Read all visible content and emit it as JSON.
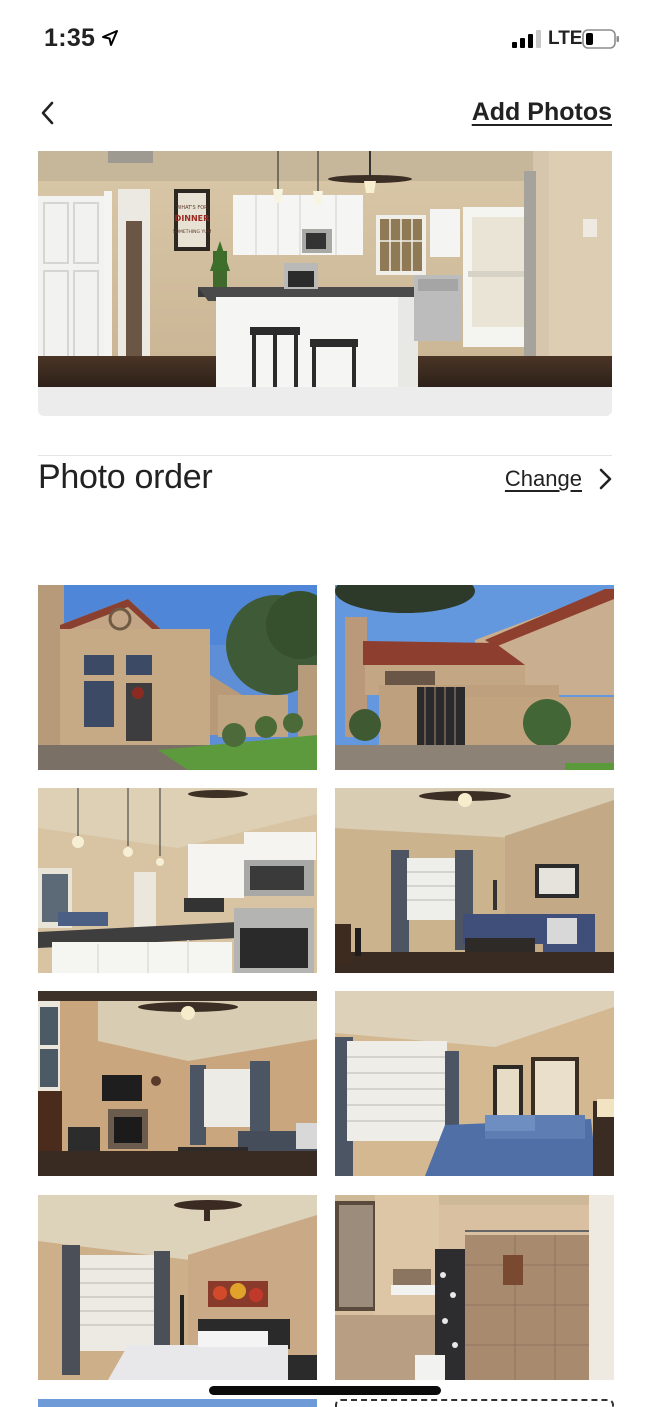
{
  "status_bar": {
    "time": "1:35",
    "network": "LTE",
    "icons": [
      "location-arrow-icon",
      "cellular-signal-icon",
      "battery-icon"
    ],
    "signal_bars": 3
  },
  "nav": {
    "back_icon": "chevron-left-icon",
    "add_photos_label": "Add Photos"
  },
  "hero_photo": {
    "scene": "kitchen",
    "sign_text": [
      "WHAT'S FOR",
      "DINNER",
      "SOMETHING YUM"
    ]
  },
  "photo_order": {
    "title": "Photo order",
    "change_label": "Change",
    "change_icon": "chevron-right-icon"
  },
  "photos": [
    {
      "scene": "exterior-front"
    },
    {
      "scene": "exterior-gate"
    },
    {
      "scene": "kitchen-open-plan"
    },
    {
      "scene": "living-room-sofa"
    },
    {
      "scene": "living-room-fireplace"
    },
    {
      "scene": "bedroom-blue-quilt"
    },
    {
      "scene": "bedroom-ceiling-fan"
    },
    {
      "scene": "bathroom-shower"
    }
  ],
  "colors": {
    "text": "#222222",
    "divider": "#e4e4e4",
    "caption_bar": "#ececec",
    "home_indicator": "#0b0b0b"
  }
}
